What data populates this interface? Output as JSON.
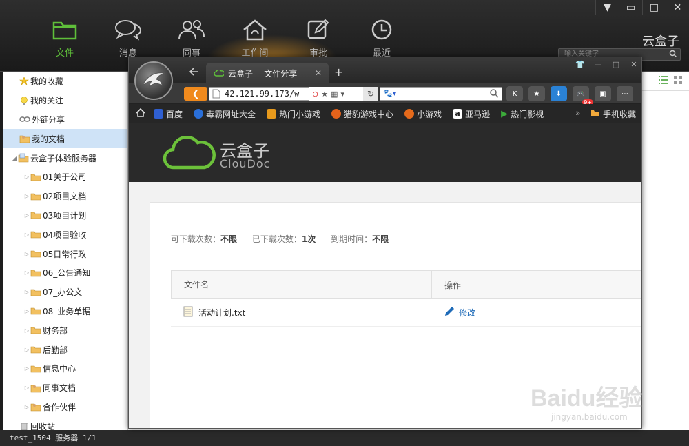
{
  "app": {
    "brand": "云盒子",
    "search_placeholder": "输入关键字",
    "nav": [
      {
        "label": "文件",
        "icon": "folder-icon",
        "active": true
      },
      {
        "label": "消息",
        "icon": "chat-bubbles-icon",
        "active": false
      },
      {
        "label": "同事",
        "icon": "people-icon",
        "active": false
      },
      {
        "label": "工作间",
        "icon": "house-icon",
        "active": false
      },
      {
        "label": "审批",
        "icon": "edit-pen-icon",
        "active": false
      },
      {
        "label": "最近",
        "icon": "clock-icon",
        "active": false
      }
    ],
    "window_buttons": [
      "▼",
      "▭",
      "□",
      "✕"
    ]
  },
  "sidebar": {
    "items": [
      {
        "label": "我的收藏",
        "icon": "star-icon",
        "level": 0,
        "selected": false
      },
      {
        "label": "我的关注",
        "icon": "bulb-icon",
        "level": 0,
        "selected": false
      },
      {
        "label": "外链分享",
        "icon": "link-icon",
        "level": 0,
        "selected": false
      },
      {
        "label": "我的文档",
        "icon": "user-folder-icon",
        "level": 0,
        "selected": true
      },
      {
        "label": "云盒子体验服务器",
        "icon": "server-folder-icon",
        "level": 0,
        "selected": false,
        "expanded": true
      },
      {
        "label": "01关于公司",
        "icon": "folder-icon",
        "level": 1,
        "selected": false
      },
      {
        "label": "02项目文档",
        "icon": "folder-icon",
        "level": 1,
        "selected": false
      },
      {
        "label": "03项目计划",
        "icon": "folder-icon",
        "level": 1,
        "selected": false
      },
      {
        "label": "04项目验收",
        "icon": "folder-icon",
        "level": 1,
        "selected": false
      },
      {
        "label": "05日常行政",
        "icon": "folder-icon",
        "level": 1,
        "selected": false
      },
      {
        "label": "06_公告通知",
        "icon": "folder-icon",
        "level": 1,
        "selected": false
      },
      {
        "label": "07_办公文",
        "icon": "folder-icon",
        "level": 1,
        "selected": false
      },
      {
        "label": "08_业务单据",
        "icon": "folder-icon",
        "level": 1,
        "selected": false
      },
      {
        "label": "财务部",
        "icon": "folder-icon",
        "level": 1,
        "selected": false
      },
      {
        "label": "后勤部",
        "icon": "folder-icon",
        "level": 1,
        "selected": false
      },
      {
        "label": "信息中心",
        "icon": "folder-icon",
        "level": 1,
        "selected": false
      },
      {
        "label": "同事文档",
        "icon": "user-folder-icon",
        "level": 1,
        "selected": false
      },
      {
        "label": "合作伙伴",
        "icon": "user-folder-icon",
        "level": 1,
        "selected": false
      },
      {
        "label": "回收站",
        "icon": "trash-icon",
        "level": 0,
        "selected": false
      }
    ]
  },
  "statusbar": {
    "text": "test_1504  服务器 1/1"
  },
  "browser": {
    "tab_title": "云盒子 -- 文件分享",
    "url": "42.121.99.173/w",
    "bookmarks": [
      {
        "label": "百度",
        "color": "#2f5fd1"
      },
      {
        "label": "毒霸网址大全",
        "color": "#2a6fd8"
      },
      {
        "label": "热门小游戏",
        "color": "#e89a1c"
      },
      {
        "label": "猎豹游戏中心",
        "color": "#e5631b"
      },
      {
        "label": "小游戏",
        "color": "#e56a1b"
      },
      {
        "label": "亚马逊",
        "color": "#222222"
      },
      {
        "label": "热门影视",
        "color": "#3cab3a"
      }
    ],
    "mobile_bookmark": "手机收藏",
    "badge": "9+"
  },
  "share_page": {
    "brand_cn": "云盒子",
    "brand_en": "ClouDoc",
    "download_limit_label": "可下载次数：",
    "download_limit_value": "不限",
    "downloaded_label": "已下载次数：",
    "downloaded_value": "1次",
    "expire_label": "到期时间：",
    "expire_value": "不限",
    "table": {
      "headers": [
        "文件名",
        "操作"
      ],
      "rows": [
        {
          "name": "活动计划.txt",
          "action": "修改"
        }
      ]
    }
  },
  "watermark": {
    "text": "Baidu经验",
    "sub": "jingyan.baidu.com"
  },
  "colors": {
    "accent_green": "#5fbf3a",
    "orange": "#f08a1d",
    "link_blue": "#1e6bb8",
    "selected_bg": "#cfe3f7"
  }
}
